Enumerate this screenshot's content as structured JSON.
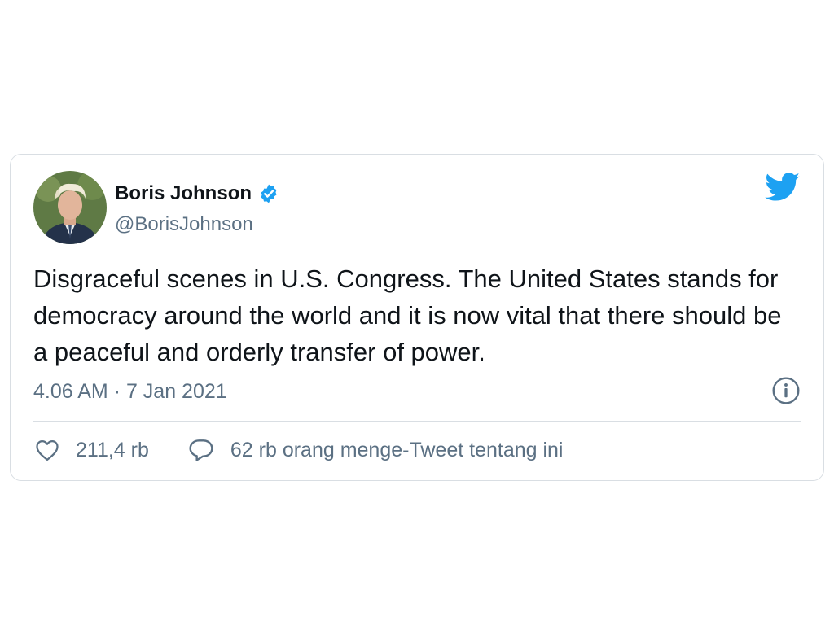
{
  "author": {
    "display_name": "Boris Johnson",
    "handle": "@BorisJohnson",
    "verified": true,
    "avatar_icon": "profile-photo"
  },
  "tweet": {
    "text": "Disgraceful scenes in U.S. Congress. The United States stands for democracy around the world and it is now vital that there should be a peaceful and orderly transfer of power.",
    "timestamp": "4.06 AM · 7 Jan 2021"
  },
  "actions": {
    "like_icon": "heart-icon",
    "like_count": "211,4 rb",
    "reply_icon": "speech-bubble-icon",
    "retweet_text": "62 rb orang menge-Tweet tentang ini"
  },
  "icons": {
    "brand": "twitter-bird-icon",
    "info": "info-icon",
    "verified": "verified-badge-icon"
  },
  "colors": {
    "twitter_blue": "#1da1f2",
    "text_primary": "#0f1419",
    "text_secondary": "#5b7083",
    "border": "#d9dee3"
  }
}
